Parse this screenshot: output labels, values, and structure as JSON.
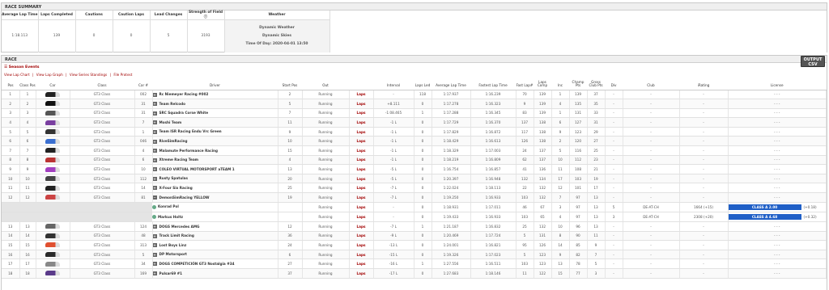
{
  "summary": {
    "title": "RACE SUMMARY",
    "headers": [
      "Average Lap Time",
      "Laps Completed",
      "Cautions",
      "Caution Laps",
      "Lead Changes",
      "Strength of Field ⓘ",
      "Weather"
    ],
    "values": [
      "1:18.113",
      "139",
      "0",
      "0",
      "5",
      "3193"
    ],
    "weather": [
      "Dynamic Weather",
      "Dynamic Skies",
      "Time Of Day: 2020-04-01 13:50"
    ]
  },
  "race": {
    "title": "RACE",
    "csv_button": [
      "OUTPUT",
      "CSV"
    ],
    "session_events": "Season Events",
    "links": [
      "View Lap Chart",
      "|",
      "View Lap Graph",
      "|",
      "View Series Standings",
      "|",
      "File Protest"
    ],
    "headers": [
      "Pos",
      "Class Pos",
      "Car",
      "Class",
      "Car #",
      "Driver",
      "Start Pos",
      "Out",
      "",
      "Interval",
      "Laps Led",
      "Average Lap Time",
      "Fastest Lap Time",
      "Fast Lap#",
      "Laps Comp",
      "Inc",
      "Champ Pts",
      "Gross Club Pts",
      "Div",
      "Club",
      "iRating",
      "License"
    ],
    "laps_label": "Laps",
    "rows": [
      [
        "1",
        "1",
        "GT3 Class",
        "002",
        "Rc Niemeyer Racing #002",
        "2",
        "Running",
        "-",
        "118",
        "1:17.937",
        "1:16.239",
        "70",
        "139",
        "1",
        "139",
        "37",
        "-",
        "-",
        "-",
        "- - -"
      ],
      [
        "2",
        "2",
        "GT3 Class",
        "31",
        "Team Relcodo",
        "5",
        "Running",
        "+8.111",
        "0",
        "1:17.278",
        "1:16.323",
        "9",
        "139",
        "4",
        "135",
        "35",
        "-",
        "-",
        "-",
        "- - -"
      ],
      [
        "3",
        "3",
        "GT3 Class",
        "31",
        "SRC Squadra Corse White",
        "7",
        "Running",
        "-1:08.465",
        "1",
        "1:17.288",
        "1:16.345",
        "83",
        "139",
        "1",
        "131",
        "33",
        "-",
        "-",
        "-",
        "- - -"
      ],
      [
        "4",
        "4",
        "GT3 Class",
        "7",
        "Moshi Team",
        "11",
        "Running",
        "-1 L",
        "0",
        "1:17.729",
        "1:16.370",
        "137",
        "138",
        "6",
        "127",
        "31",
        "-",
        "-",
        "-",
        "- - -"
      ],
      [
        "5",
        "5",
        "GT3 Class",
        "1",
        "Team ISR Racing Endu Vrc Green",
        "9",
        "Running",
        "-1 L",
        "0",
        "1:17.829",
        "1:16.872",
        "117",
        "138",
        "9",
        "123",
        "29",
        "-",
        "-",
        "-",
        "- - -"
      ],
      [
        "6",
        "6",
        "GT3 Class",
        "046",
        "RiveSimRacing",
        "10",
        "Running",
        "-1 L",
        "0",
        "1:18.429",
        "1:16.613",
        "126",
        "138",
        "2",
        "120",
        "27",
        "-",
        "-",
        "-",
        "- - -"
      ],
      [
        "7",
        "7",
        "GT3 Class",
        "4",
        "Malamute Performance Racing",
        "15",
        "Running",
        "-1 L",
        "0",
        "1:18.329",
        "1:17.003",
        "24",
        "137",
        "5",
        "116",
        "25",
        "-",
        "-",
        "-",
        "- - -"
      ],
      [
        "8",
        "8",
        "GT3 Class",
        "6",
        "Xtreme Racing Team",
        "4",
        "Running",
        "-1 L",
        "0",
        "1:18.219",
        "1:16.809",
        "62",
        "137",
        "10",
        "112",
        "23",
        "-",
        "-",
        "-",
        "- - -"
      ],
      [
        "9",
        "9",
        "GT3 Class",
        "10",
        "COLEO VIRTUAL MOTORSPORT aTEAM 1",
        "13",
        "Running",
        "-5 L",
        "0",
        "1:16.754",
        "1:16.857",
        "41",
        "136",
        "11",
        "108",
        "21",
        "-",
        "-",
        "-",
        "- - -"
      ],
      [
        "10",
        "10",
        "GT3 Class",
        "112",
        "Rusty Spatulas",
        "20",
        "Running",
        "-5 L",
        "0",
        "1:20.397",
        "1:16.948",
        "132",
        "134",
        "17",
        "103",
        "19",
        "-",
        "-",
        "-",
        "- - -"
      ],
      [
        "11",
        "11",
        "GT3 Class",
        "14",
        "X-Four Six Racing",
        "25",
        "Running",
        "-7 L",
        "0",
        "1:22.024",
        "1:18.113",
        "22",
        "132",
        "12",
        "101",
        "17",
        "-",
        "-",
        "-",
        "- - -"
      ],
      [
        "12",
        "12",
        "GT3 Class",
        "81",
        "DemonSimRacing YELLOW",
        "19",
        "Running",
        "-7 L",
        "0",
        "1:19.250",
        "1:16.933",
        "103",
        "132",
        "7",
        "97",
        "13",
        "-",
        "-",
        "-",
        "- - -"
      ],
      [
        "13",
        "13",
        "GT3 Class",
        "124",
        "DOGS Mercedes AMG",
        "12",
        "Running",
        "-7 L",
        "1",
        "1:21.187",
        "1:16.832",
        "25",
        "132",
        "10",
        "96",
        "13",
        "-",
        "-",
        "-",
        "- - -"
      ],
      [
        "14",
        "14",
        "GT3 Class",
        "48",
        "Track Limit Racing",
        "36",
        "Running",
        "-9 L",
        "0",
        "1:20.469",
        "1:17.724",
        "5",
        "131",
        "8",
        "90",
        "11",
        "-",
        "-",
        "-",
        "- - -"
      ],
      [
        "15",
        "15",
        "GT3 Class",
        "313",
        "Lost Boys Linz",
        "24",
        "Running",
        "-13 L",
        "0",
        "1:24.001",
        "1:16.821",
        "95",
        "126",
        "14",
        "85",
        "9",
        "-",
        "-",
        "-",
        "- - -"
      ],
      [
        "16",
        "16",
        "GT3 Class",
        "5",
        "DP Motorsport",
        "6",
        "Running",
        "-15 L",
        "0",
        "1:19.326",
        "1:17.023",
        "5",
        "123",
        "9",
        "82",
        "7",
        "-",
        "-",
        "-",
        "- - -"
      ],
      [
        "17",
        "17",
        "GT3 Class",
        "34",
        "DOGS COMPETICIÓN GT3 Nostalgia #34",
        "27",
        "Running",
        "-16 L",
        "1",
        "1:27.556",
        "1:16.511",
        "103",
        "123",
        "13",
        "78",
        "5",
        "-",
        "-",
        "-",
        "- - -"
      ],
      [
        "18",
        "18",
        "GT3 Class",
        "169",
        "Pulsar69 #1",
        "37",
        "Running",
        "-17 L",
        "0",
        "1:27.683",
        "1:18.146",
        "11",
        "122",
        "15",
        "77",
        "3",
        "-",
        "-",
        "-",
        "- - -"
      ]
    ],
    "expanded_after": 11,
    "subrows": [
      {
        "driver": "Konrad Pol",
        "out": "Running",
        "interval": "-",
        "led": "0",
        "avg": "1:18.931",
        "fast": "1:17.011",
        "lapno": "46",
        "comp": "67",
        "inc": "3",
        "champ": "97",
        "club": "13",
        "div": "5",
        "clubname": "DE-AT-CH",
        "irating": "1664 (+15)",
        "license": "CLASS A 2.00",
        "delta": "(+0.18)"
      },
      {
        "driver": "Markus Holtz",
        "out": "Running",
        "interval": "-",
        "led": "0",
        "avg": "1:19.433",
        "fast": "1:16.933",
        "lapno": "103",
        "comp": "65",
        "inc": "4",
        "champ": "97",
        "club": "13",
        "div": "3",
        "clubname": "DE-AT-CH",
        "irating": "2308 (+20)",
        "license": "CLASS A 4.68",
        "delta": "(+0.32)"
      }
    ]
  },
  "colors": {
    "accent": "#a10000",
    "license_bar": "#1f5fc7"
  }
}
